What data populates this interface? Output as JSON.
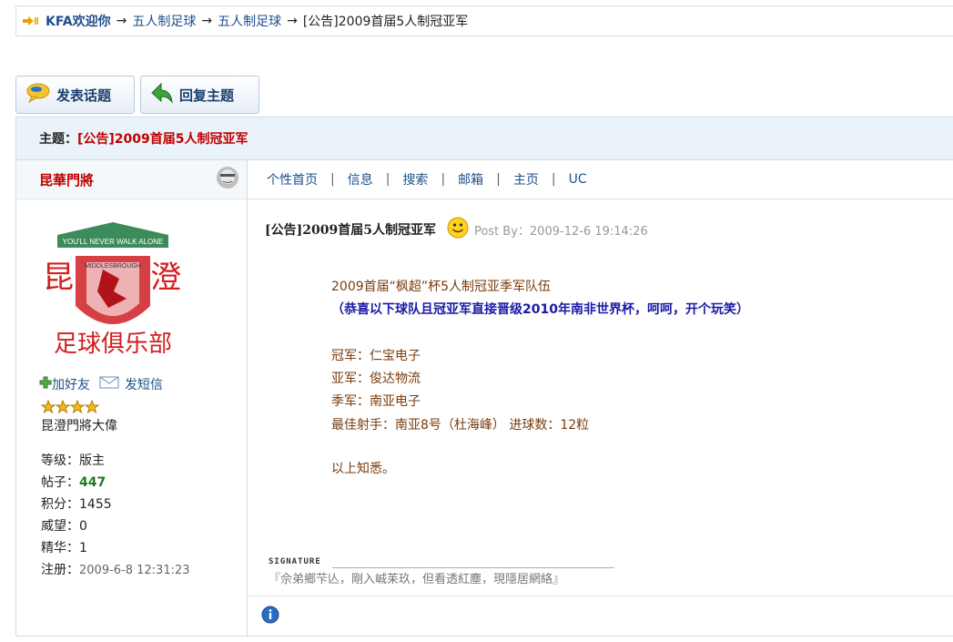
{
  "breadcrumb": {
    "home": "KFA欢迎你",
    "crumb1": "五人制足球",
    "crumb2": "五人制足球",
    "current": "[公告]2009首届5人制冠亚军",
    "arrow": "→"
  },
  "toolbar": {
    "new_topic": "发表话题",
    "reply": "回复主题"
  },
  "subject": {
    "label": "主题：",
    "title": "[公告]2009首届5人制冠亚军"
  },
  "author": {
    "name": "昆華門將",
    "add_friend": "加好友",
    "send_msg": "发短信",
    "rank_title": "昆澄門將大偉",
    "stars": 4,
    "stats": {
      "level_label": "等级：",
      "level": "版主",
      "posts_label": "帖子：",
      "posts": "447",
      "points_label": "积分：",
      "points": "1455",
      "prestige_label": "威望：",
      "prestige": "0",
      "essence_label": "精华：",
      "essence": "1",
      "registered_label": "注册：",
      "registered": "2009-6-8 12:31:23"
    },
    "avatar_text": {
      "top": "YOU'LL NEVER WALK ALONE",
      "middle": "MIDDLESBROUGH",
      "left_char": "昆",
      "right_char": "澄",
      "bottom": "足球俱乐部"
    }
  },
  "menu": {
    "items": [
      "个性首页",
      "信息",
      "搜索",
      "邮箱",
      "主页",
      "UC"
    ],
    "separator": "|"
  },
  "post": {
    "title": "[公告]2009首届5人制冠亚军",
    "by": "Post By：2009-12-6 19:14:26",
    "lines": {
      "l1": "2009首届“枫超”杯5人制冠亚季军队伍",
      "l2": "（恭喜以下球队且冠亚军直接晋级2010年南非世界杯，呵呵，开个玩笑）",
      "l3": "冠军：仁宝电子",
      "l4": "亚军：俊达物流",
      "l5": "季军：南亚电子",
      "l6": "最佳射手：南亚8号（杜海峰） 进球数：12粒",
      "l7": "以上知悉。"
    },
    "signature_label": "SIGNATURE",
    "signature_dashes": "______________________________________________",
    "signature": "『佘弟鄉芐亾，剛入峸苿玖，但看透紅塵，現隱居網絡』"
  },
  "colors": {
    "link": "#1f4f8d",
    "title_red": "#c00000",
    "content_brown": "#7a3c0e",
    "content_blue": "#1a1aa6"
  }
}
